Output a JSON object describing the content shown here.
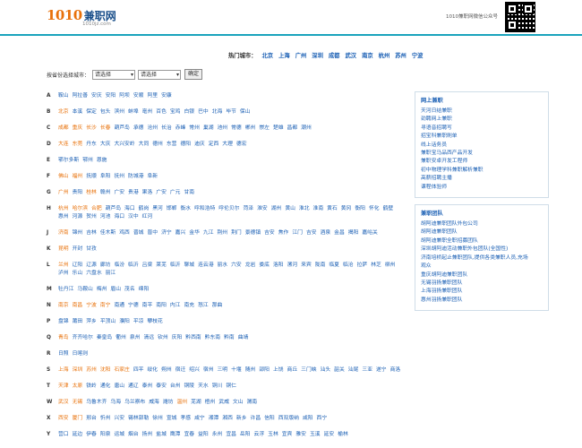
{
  "header": {
    "logo_num": "1010",
    "logo_cn": "兼职网",
    "logo_domain": "1010jz.com",
    "wechat_text": "1010兼职网微信公众号"
  },
  "hot_cities": {
    "label": "热门城市：",
    "items": [
      "北京",
      "上海",
      "广州",
      "深圳",
      "成都",
      "武汉",
      "南京",
      "杭州",
      "苏州",
      "宁波"
    ]
  },
  "selector": {
    "label": "按省份选择城市：",
    "province": "请选择",
    "city": "请选择",
    "button": "确定"
  },
  "city_rows": [
    {
      "letter": "A",
      "cities": [
        {
          "n": "鞍山"
        },
        {
          "n": "阿拉善"
        },
        {
          "n": "安庆"
        },
        {
          "n": "安阳"
        },
        {
          "n": "阿坝"
        },
        {
          "n": "安顺"
        },
        {
          "n": "阿里"
        },
        {
          "n": "安康"
        }
      ]
    },
    {
      "letter": "B",
      "cities": [
        {
          "n": "北京",
          "hl": true
        },
        {
          "n": "本溪"
        },
        {
          "n": "保定"
        },
        {
          "n": "包头"
        },
        {
          "n": "滨州"
        },
        {
          "n": "蚌埠"
        },
        {
          "n": "亳州"
        },
        {
          "n": "百色"
        },
        {
          "n": "宝鸡"
        },
        {
          "n": "白银"
        },
        {
          "n": "巴中"
        },
        {
          "n": "北海"
        },
        {
          "n": "毕节"
        },
        {
          "n": "保山"
        }
      ]
    },
    {
      "letter": "C",
      "cities": [
        {
          "n": "成都",
          "hl": true
        },
        {
          "n": "重庆",
          "hl": true
        },
        {
          "n": "长沙",
          "hl": true
        },
        {
          "n": "长春",
          "hl": true
        },
        {
          "n": "葫芦岛"
        },
        {
          "n": "承德"
        },
        {
          "n": "沧州"
        },
        {
          "n": "长治"
        },
        {
          "n": "赤峰"
        },
        {
          "n": "常州"
        },
        {
          "n": "巢湖"
        },
        {
          "n": "池州"
        },
        {
          "n": "常德"
        },
        {
          "n": "郴州"
        },
        {
          "n": "崇左"
        },
        {
          "n": "楚雄"
        },
        {
          "n": "昌都"
        },
        {
          "n": "潮州"
        }
      ]
    },
    {
      "letter": "D",
      "cities": [
        {
          "n": "大连",
          "hl": true
        },
        {
          "n": "东莞",
          "hl": true
        },
        {
          "n": "丹东"
        },
        {
          "n": "大庆"
        },
        {
          "n": "大兴安岭"
        },
        {
          "n": "大同"
        },
        {
          "n": "德州"
        },
        {
          "n": "东营"
        },
        {
          "n": "德阳"
        },
        {
          "n": "迪庆"
        },
        {
          "n": "定西"
        },
        {
          "n": "大理"
        },
        {
          "n": "德宏"
        }
      ]
    },
    {
      "letter": "E",
      "cities": [
        {
          "n": "鄂尔多斯"
        },
        {
          "n": "鄂州"
        },
        {
          "n": "恩施"
        }
      ]
    },
    {
      "letter": "F",
      "cities": [
        {
          "n": "佛山",
          "hl": true
        },
        {
          "n": "福州",
          "hl": true
        },
        {
          "n": "抚顺"
        },
        {
          "n": "阜阳"
        },
        {
          "n": "抚州"
        },
        {
          "n": "防城港"
        },
        {
          "n": "阜新"
        }
      ]
    },
    {
      "letter": "G",
      "cities": [
        {
          "n": "广州",
          "hl": true
        },
        {
          "n": "贵阳"
        },
        {
          "n": "桂林",
          "hl": true
        },
        {
          "n": "赣州"
        },
        {
          "n": "广安"
        },
        {
          "n": "贵港"
        },
        {
          "n": "果洛"
        },
        {
          "n": "广安"
        },
        {
          "n": "广元"
        },
        {
          "n": "甘南"
        }
      ]
    },
    {
      "letter": "H",
      "cities": [
        {
          "n": "杭州",
          "hl": true
        },
        {
          "n": "哈尔滨",
          "hl": true
        },
        {
          "n": "合肥",
          "hl": true
        },
        {
          "n": "葫芦岛"
        },
        {
          "n": "海口"
        },
        {
          "n": "鹤岗"
        },
        {
          "n": "黑河"
        },
        {
          "n": "邯郸"
        },
        {
          "n": "衡水"
        },
        {
          "n": "呼和浩特"
        },
        {
          "n": "呼伦贝尔"
        },
        {
          "n": "菏泽"
        },
        {
          "n": "淮安"
        },
        {
          "n": "湖州"
        },
        {
          "n": "黄山"
        },
        {
          "n": "淮北"
        },
        {
          "n": "淮南"
        },
        {
          "n": "黄石"
        },
        {
          "n": "黄冈"
        },
        {
          "n": "衡阳"
        },
        {
          "n": "怀化"
        },
        {
          "n": "鹤壁"
        },
        {
          "n": "惠州"
        },
        {
          "n": "河源"
        },
        {
          "n": "贺州"
        },
        {
          "n": "河池"
        },
        {
          "n": "海口"
        },
        {
          "n": "汉中"
        },
        {
          "n": "红河"
        }
      ]
    },
    {
      "letter": "J",
      "cities": [
        {
          "n": "济南",
          "hl": true
        },
        {
          "n": "锦州"
        },
        {
          "n": "吉林"
        },
        {
          "n": "佳木斯"
        },
        {
          "n": "鸡西"
        },
        {
          "n": "晋城"
        },
        {
          "n": "晋中"
        },
        {
          "n": "济宁"
        },
        {
          "n": "嘉兴"
        },
        {
          "n": "金华"
        },
        {
          "n": "九江"
        },
        {
          "n": "荆州"
        },
        {
          "n": "荆门"
        },
        {
          "n": "景德镇"
        },
        {
          "n": "吉安"
        },
        {
          "n": "焦作"
        },
        {
          "n": "江门"
        },
        {
          "n": "吉安"
        },
        {
          "n": "酒泉"
        },
        {
          "n": "金昌"
        },
        {
          "n": "揭阳"
        },
        {
          "n": "嘉峪关"
        }
      ]
    },
    {
      "letter": "K",
      "cities": [
        {
          "n": "昆明",
          "hl": true
        },
        {
          "n": "开封"
        },
        {
          "n": "甘孜"
        }
      ]
    },
    {
      "letter": "L",
      "cities": [
        {
          "n": "兰州",
          "hl": true
        },
        {
          "n": "辽阳"
        },
        {
          "n": "辽源"
        },
        {
          "n": "廊坊"
        },
        {
          "n": "临汾"
        },
        {
          "n": "临沂"
        },
        {
          "n": "吕梁"
        },
        {
          "n": "莱芜"
        },
        {
          "n": "临沂"
        },
        {
          "n": "聊城"
        },
        {
          "n": "连云港"
        },
        {
          "n": "丽水"
        },
        {
          "n": "六安"
        },
        {
          "n": "龙岩"
        },
        {
          "n": "娄底"
        },
        {
          "n": "洛阳"
        },
        {
          "n": "漯河"
        },
        {
          "n": "来宾"
        },
        {
          "n": "陇南"
        },
        {
          "n": "临夏"
        },
        {
          "n": "临沧"
        },
        {
          "n": "拉萨"
        },
        {
          "n": "林芝"
        },
        {
          "n": "柳州"
        },
        {
          "n": "泸州"
        },
        {
          "n": "乐山"
        },
        {
          "n": "六盘水"
        },
        {
          "n": "丽江"
        }
      ]
    },
    {
      "letter": "M",
      "cities": [
        {
          "n": "牡丹江"
        },
        {
          "n": "马鞍山"
        },
        {
          "n": "梅州"
        },
        {
          "n": "眉山"
        },
        {
          "n": "茂名"
        },
        {
          "n": "绵阳"
        }
      ]
    },
    {
      "letter": "N",
      "cities": [
        {
          "n": "南京",
          "hl": true
        },
        {
          "n": "南昌",
          "hl": true
        },
        {
          "n": "宁波",
          "hl": true
        },
        {
          "n": "南宁",
          "hl": true
        },
        {
          "n": "南通"
        },
        {
          "n": "宁德"
        },
        {
          "n": "南平"
        },
        {
          "n": "南阳"
        },
        {
          "n": "内江"
        },
        {
          "n": "南充"
        },
        {
          "n": "怒江"
        },
        {
          "n": "那曲"
        }
      ]
    },
    {
      "letter": "P",
      "cities": [
        {
          "n": "盘锦"
        },
        {
          "n": "莆田"
        },
        {
          "n": "萍乡"
        },
        {
          "n": "平顶山"
        },
        {
          "n": "濮阳"
        },
        {
          "n": "平凉"
        },
        {
          "n": "攀枝花"
        }
      ]
    },
    {
      "letter": "Q",
      "cities": [
        {
          "n": "青岛",
          "hl": true
        },
        {
          "n": "齐齐哈尔"
        },
        {
          "n": "秦皇岛"
        },
        {
          "n": "衢州"
        },
        {
          "n": "泉州"
        },
        {
          "n": "清远"
        },
        {
          "n": "钦州"
        },
        {
          "n": "庆阳"
        },
        {
          "n": "黔西南"
        },
        {
          "n": "黔东南"
        },
        {
          "n": "黔南"
        },
        {
          "n": "曲靖"
        }
      ]
    },
    {
      "letter": "R",
      "cities": [
        {
          "n": "日照"
        },
        {
          "n": "日喀则"
        }
      ]
    },
    {
      "letter": "S",
      "cities": [
        {
          "n": "上海",
          "hl": true
        },
        {
          "n": "深圳",
          "hl": true
        },
        {
          "n": "苏州",
          "hl": true
        },
        {
          "n": "沈阳",
          "hl": true
        },
        {
          "n": "石家庄",
          "hl": true
        },
        {
          "n": "四平"
        },
        {
          "n": "绥化"
        },
        {
          "n": "朔州"
        },
        {
          "n": "宿迁"
        },
        {
          "n": "绍兴"
        },
        {
          "n": "宿州"
        },
        {
          "n": "三明"
        },
        {
          "n": "十堰"
        },
        {
          "n": "随州"
        },
        {
          "n": "邵阳"
        },
        {
          "n": "上饶"
        },
        {
          "n": "商丘"
        },
        {
          "n": "三门峡"
        },
        {
          "n": "汕头"
        },
        {
          "n": "韶关"
        },
        {
          "n": "汕尾"
        },
        {
          "n": "三亚"
        },
        {
          "n": "遂宁"
        },
        {
          "n": "商洛"
        }
      ]
    },
    {
      "letter": "T",
      "cities": [
        {
          "n": "天津",
          "hl": true
        },
        {
          "n": "太原",
          "hl": true
        },
        {
          "n": "铁岭"
        },
        {
          "n": "通化"
        },
        {
          "n": "唐山"
        },
        {
          "n": "通辽"
        },
        {
          "n": "泰州"
        },
        {
          "n": "泰安"
        },
        {
          "n": "台州"
        },
        {
          "n": "铜陵"
        },
        {
          "n": "天水"
        },
        {
          "n": "铜川"
        },
        {
          "n": "铜仁"
        }
      ]
    },
    {
      "letter": "W",
      "cities": [
        {
          "n": "武汉",
          "hl": true
        },
        {
          "n": "无锡",
          "hl": true
        },
        {
          "n": "乌鲁木齐"
        },
        {
          "n": "乌海"
        },
        {
          "n": "乌兰察布"
        },
        {
          "n": "威海"
        },
        {
          "n": "潍坊"
        },
        {
          "n": "温州",
          "hl": true
        },
        {
          "n": "芜湖"
        },
        {
          "n": "梧州"
        },
        {
          "n": "武威"
        },
        {
          "n": "文山"
        },
        {
          "n": "渭南"
        }
      ]
    },
    {
      "letter": "X",
      "cities": [
        {
          "n": "西安",
          "hl": true
        },
        {
          "n": "厦门",
          "hl": true
        },
        {
          "n": "邢台"
        },
        {
          "n": "忻州"
        },
        {
          "n": "兴安"
        },
        {
          "n": "锡林郭勒"
        },
        {
          "n": "徐州"
        },
        {
          "n": "宣城"
        },
        {
          "n": "孝感"
        },
        {
          "n": "咸宁"
        },
        {
          "n": "湘潭"
        },
        {
          "n": "湘西"
        },
        {
          "n": "新乡"
        },
        {
          "n": "许昌"
        },
        {
          "n": "信阳"
        },
        {
          "n": "西双版纳"
        },
        {
          "n": "咸阳"
        },
        {
          "n": "西宁"
        }
      ]
    },
    {
      "letter": "Y",
      "cities": [
        {
          "n": "营口"
        },
        {
          "n": "延边"
        },
        {
          "n": "伊春"
        },
        {
          "n": "阳泉"
        },
        {
          "n": "运城"
        },
        {
          "n": "烟台"
        },
        {
          "n": "扬州"
        },
        {
          "n": "盐城"
        },
        {
          "n": "鹰潭"
        },
        {
          "n": "宜春"
        },
        {
          "n": "益阳"
        },
        {
          "n": "永州"
        },
        {
          "n": "宜昌"
        },
        {
          "n": "岳阳"
        },
        {
          "n": "云浮"
        },
        {
          "n": "玉林"
        },
        {
          "n": "宜宾"
        },
        {
          "n": "雅安"
        },
        {
          "n": "玉溪"
        },
        {
          "n": "延安"
        },
        {
          "n": "榆林"
        }
      ]
    }
  ],
  "side_panels": [
    {
      "title": "网上兼职",
      "links": [
        "天河日结兼职",
        "劲聘网上兼职",
        "寻语音招聘写",
        "招宝科兼职刷单",
        "线上话务员",
        "兼职宝马品西产品开发",
        "兼职安卓开发工程师",
        "初中物理学科兼职解析兼职",
        "高薪招聘主播",
        "课程体验师"
      ]
    },
    {
      "title": "兼职团队",
      "links": [
        "胡阿迪兼职团队外包公司",
        "胡阿迪兼职团队",
        "胡阿迪兼职全职招募团队",
        "深圳胡阿迪活动兼职外包团队(全国性)",
        "济南培桥起止兼职团队,提供各类兼职人员,充场",
        "观众",
        "重庆胡阿迪兼职团队",
        "无锡羽扬兼职团队",
        "上海羽扬兼职团队",
        "惠州羽扬兼职团队"
      ]
    }
  ]
}
